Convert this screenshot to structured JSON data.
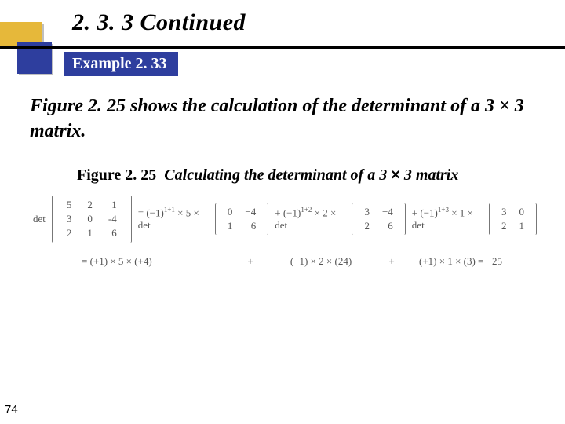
{
  "heading": "2. 3. 3   Continued",
  "example_label": "Example 2. 33",
  "body_text": "Figure 2. 25 shows the calculation of the determinant of a 3 × 3 matrix.",
  "figure_label": "Figure 2. 25",
  "figure_caption_prefix": "Calculating the determinant of a 3 ",
  "figure_caption_mul": "×",
  "figure_caption_suffix": " 3 matrix",
  "eq": {
    "det_label": "det",
    "mat3": [
      [
        "5",
        "2",
        "1"
      ],
      [
        "3",
        "0",
        "-4"
      ],
      [
        "2",
        "1",
        "6"
      ]
    ],
    "t1a": "= (−1)",
    "t1b_sup": "1+1",
    "t1c": " × 5 × det",
    "m1": [
      [
        "0",
        "−4"
      ],
      [
        "1",
        "6"
      ]
    ],
    "t2a": "+  (−1)",
    "t2b_sup": "1+2",
    "t2c": " × 2 × det",
    "m2": [
      [
        "3",
        "−4"
      ],
      [
        "2",
        "6"
      ]
    ],
    "t3a": "+  (−1)",
    "t3b_sup": "1+3",
    "t3c": " × 1 × det",
    "m3": [
      [
        "3",
        "0"
      ],
      [
        "2",
        "1"
      ]
    ],
    "r2_eq": "= (+1) × 5 × (+4)",
    "r2_p1": "+",
    "r2_b": "(−1) × 2 × (24)",
    "r2_p2": "+",
    "r2_c": "(+1) × 1 × (3) = −25"
  },
  "page_number": "74"
}
